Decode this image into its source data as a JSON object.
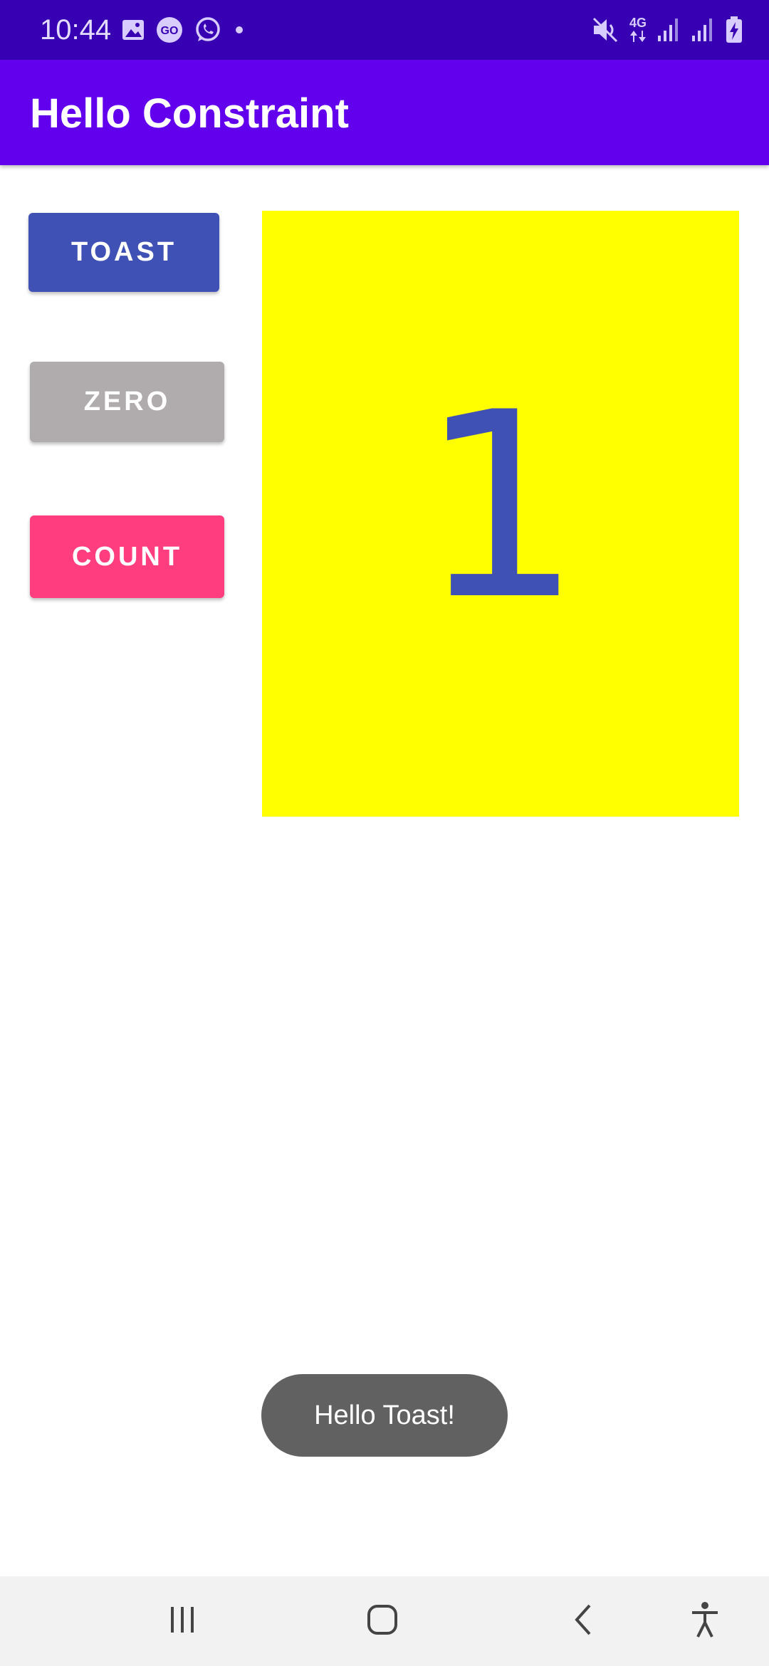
{
  "status_bar": {
    "time": "10:44",
    "network_label": "4G",
    "icons": [
      "image-icon",
      "go-app-icon",
      "whatsapp-icon",
      "notification-dot-icon",
      "mute-icon",
      "data-arrows-icon",
      "signal-icon",
      "signal-icon",
      "battery-charging-icon"
    ]
  },
  "app_bar": {
    "title": "Hello Constraint"
  },
  "buttons": {
    "toast_label": "TOAST",
    "zero_label": "ZERO",
    "count_label": "COUNT"
  },
  "counter": {
    "value": "1"
  },
  "toast": {
    "message": "Hello Toast!"
  },
  "nav_bar": {
    "icons": [
      "recent-apps-icon",
      "home-icon",
      "back-icon",
      "accessibility-icon"
    ]
  },
  "colors": {
    "status_bar": "#3700b3",
    "app_bar": "#6200ee",
    "toast_button": "#3f51b5",
    "zero_button": "#b0abac",
    "count_button": "#ff3d7f",
    "count_panel": "#ffff00",
    "count_text": "#3f51b5",
    "toast_bg": "#616161"
  }
}
